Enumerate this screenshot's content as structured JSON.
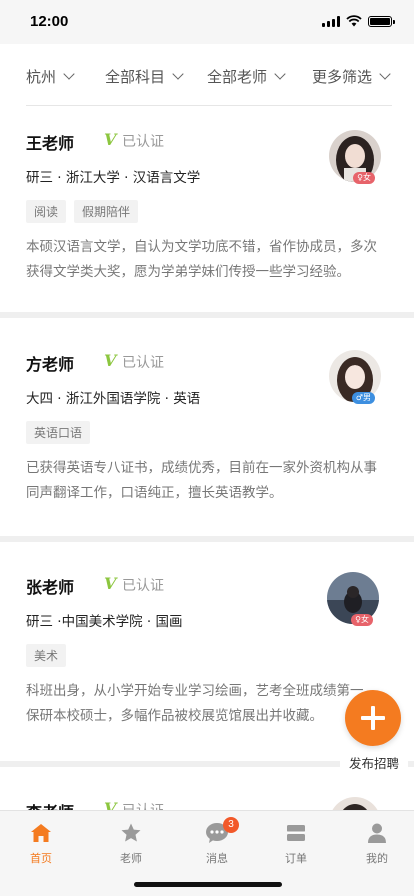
{
  "status": {
    "time": "12:00"
  },
  "filters": [
    {
      "label": "杭州"
    },
    {
      "label": "全部科目"
    },
    {
      "label": "全部老师"
    },
    {
      "label": "更多筛选"
    }
  ],
  "teachers": [
    {
      "name": "王老师",
      "verified_label": "已认证",
      "education": "研三 · 浙江大学 · 汉语言文学",
      "tags": [
        "阅读",
        "假期陪伴"
      ],
      "description": "本硕汉语言文学，自认为文学功底不错，省作协成员，多次获得文学类大奖，愿为学弟学妹们传授一些学习经验。",
      "gender_badge": "♀女"
    },
    {
      "name": "方老师",
      "verified_label": "已认证",
      "education": "大四 · 浙江外国语学院 · 英语",
      "tags": [
        "英语口语"
      ],
      "description": "已获得英语专八证书，成绩优秀，目前在一家外资机构从事同声翻译工作，口语纯正，擅长英语教学。",
      "gender_badge": "♂男"
    },
    {
      "name": "张老师",
      "verified_label": "已认证",
      "education": "研三 ·中国美术学院 · 国画",
      "tags": [
        "美术"
      ],
      "description": "科班出身，从小学开始专业学习绘画，艺考全班成绩第一，保研本校硕士，多幅作品被校展览馆展出并收藏。",
      "gender_badge": "♀女"
    },
    {
      "name": "李老师",
      "verified_label": "已认证"
    }
  ],
  "fab": {
    "icon": "plus-icon",
    "label": "发布招聘"
  },
  "tabs": [
    {
      "label": "首页",
      "icon": "home-icon",
      "active": true
    },
    {
      "label": "老师",
      "icon": "star-icon"
    },
    {
      "label": "消息",
      "icon": "chat-icon",
      "badge": "3"
    },
    {
      "label": "订单",
      "icon": "orders-icon"
    },
    {
      "label": "我的",
      "icon": "profile-icon"
    }
  ],
  "colors": {
    "accent": "#f47b20",
    "verified": "#8cc63f",
    "badge": "#f2592a"
  }
}
